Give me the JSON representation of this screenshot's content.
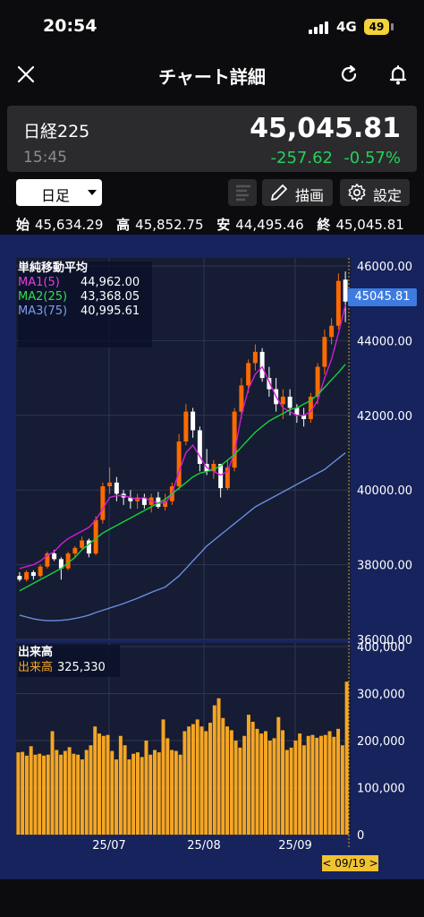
{
  "status_bar": {
    "time": "20:54",
    "network": "4G",
    "battery": "49"
  },
  "header": {
    "title": "チャート詳細"
  },
  "quote": {
    "name": "日経225",
    "price": "45,045.81",
    "time": "15:45",
    "change": "-257.62",
    "change_pct": "-0.57%"
  },
  "toolbar": {
    "period": "日足",
    "draw": "描画",
    "settings": "設定"
  },
  "ohlc": {
    "open_label": "始",
    "open": "45,634.29",
    "high_label": "高",
    "high": "45,852.75",
    "low_label": "安",
    "low": "44,495.46",
    "close_label": "終",
    "close": "45,045.81"
  },
  "ma_legend": {
    "title": "単純移動平均",
    "ma1_label": "MA1(5)",
    "ma1_value": "44,962.00",
    "ma2_label": "MA2(25)",
    "ma2_value": "43,368.05",
    "ma3_label": "MA3(75)",
    "ma3_value": "40,995.61"
  },
  "price_tag": "45045.81",
  "volume_legend": {
    "title": "出来高",
    "label": "出来高",
    "value": "325,330"
  },
  "date_tag": "< 09/19 >",
  "colors": {
    "up": "#ff6a00",
    "down": "#ffffff",
    "ma1": "#d21cd6",
    "ma2": "#16d23a",
    "ma3": "#6b8de0",
    "volume": "#f5a623",
    "bg": "#16235c",
    "plot_bg": "#151c33",
    "up_text": "#25d05b"
  },
  "chart_data": [
    {
      "type": "candlestick",
      "title": "",
      "ylim": [
        36000,
        46000
      ],
      "ytick_labels": [
        "36000.00",
        "38000.00",
        "40000.00",
        "42000.00",
        "44000.00",
        "46000.00"
      ],
      "xtick_labels": [
        "25/07",
        "25/08",
        "25/09"
      ],
      "series": [
        {
          "name": "MA1(5)",
          "values": [
            37900,
            37950,
            38000,
            38100,
            38250,
            38350,
            38550,
            38700,
            38800,
            38900,
            39000,
            39200,
            39500,
            39800,
            39850,
            39850,
            39800,
            39750,
            39800,
            39700,
            39650,
            39650,
            39900,
            40500,
            41000,
            41200,
            40900,
            40600,
            40500,
            40400,
            40500,
            41000,
            42000,
            42700,
            43100,
            43300,
            42900,
            42500,
            42200,
            42100,
            42000,
            42000,
            42100,
            42400,
            43000,
            43500,
            44200,
            44962
          ]
        },
        {
          "name": "MA2(25)",
          "values": [
            37300,
            37400,
            37500,
            37600,
            37700,
            37800,
            37900,
            38050,
            38200,
            38400,
            38550,
            38700,
            38850,
            38950,
            39050,
            39150,
            39250,
            39350,
            39450,
            39550,
            39650,
            39750,
            39900,
            40050,
            40200,
            40350,
            40450,
            40500,
            40550,
            40650,
            40800,
            40950,
            41150,
            41350,
            41550,
            41700,
            41850,
            41950,
            42050,
            42150,
            42200,
            42300,
            42400,
            42550,
            42750,
            42950,
            43150,
            43368
          ]
        },
        {
          "name": "MA3(75)",
          "values": [
            36650,
            36600,
            36550,
            36520,
            36500,
            36500,
            36510,
            36530,
            36560,
            36600,
            36650,
            36720,
            36780,
            36840,
            36900,
            36960,
            37030,
            37100,
            37180,
            37260,
            37330,
            37400,
            37550,
            37700,
            37900,
            38100,
            38300,
            38500,
            38650,
            38800,
            38950,
            39100,
            39250,
            39400,
            39550,
            39650,
            39750,
            39850,
            39950,
            40050,
            40150,
            40250,
            40350,
            40450,
            40550,
            40700,
            40850,
            40996
          ]
        }
      ],
      "candles": [
        [
          37700,
          37800,
          37550,
          37600
        ],
        [
          37600,
          37850,
          37550,
          37800
        ],
        [
          37800,
          37850,
          37600,
          37700
        ],
        [
          37700,
          38000,
          37650,
          37950
        ],
        [
          37950,
          38350,
          37900,
          38300
        ],
        [
          38300,
          38400,
          38100,
          38150
        ],
        [
          38150,
          38200,
          37600,
          37900
        ],
        [
          37900,
          38350,
          37850,
          38300
        ],
        [
          38300,
          38500,
          38200,
          38450
        ],
        [
          38450,
          38750,
          38400,
          38650
        ],
        [
          38650,
          38700,
          38200,
          38300
        ],
        [
          38300,
          39300,
          38250,
          39200
        ],
        [
          39200,
          40200,
          39100,
          40100
        ],
        [
          40100,
          40600,
          39900,
          40200
        ],
        [
          40200,
          40350,
          39700,
          39900
        ],
        [
          39900,
          40000,
          39600,
          39800
        ],
        [
          39800,
          40000,
          39500,
          39700
        ],
        [
          39700,
          39900,
          39500,
          39800
        ],
        [
          39800,
          39900,
          39500,
          39600
        ],
        [
          39600,
          39900,
          39400,
          39800
        ],
        [
          39800,
          39950,
          39500,
          39550
        ],
        [
          39550,
          39900,
          39450,
          39700
        ],
        [
          39700,
          40200,
          39600,
          40100
        ],
        [
          40100,
          41500,
          40000,
          41300
        ],
        [
          41300,
          42300,
          41200,
          42100
        ],
        [
          42100,
          42200,
          41400,
          41600
        ],
        [
          41600,
          41700,
          40500,
          40700
        ],
        [
          40700,
          41100,
          40400,
          40500
        ],
        [
          40500,
          40800,
          40300,
          40700
        ],
        [
          40700,
          40700,
          39800,
          40050
        ],
        [
          40050,
          40800,
          40000,
          40600
        ],
        [
          40600,
          42200,
          40500,
          42100
        ],
        [
          42100,
          43000,
          41900,
          42800
        ],
        [
          42800,
          43500,
          42600,
          43400
        ],
        [
          43400,
          43900,
          43200,
          43700
        ],
        [
          43700,
          43800,
          42900,
          43000
        ],
        [
          43000,
          43300,
          42500,
          42700
        ],
        [
          42700,
          43000,
          42100,
          42300
        ],
        [
          42300,
          42700,
          41900,
          42500
        ],
        [
          42500,
          42700,
          42000,
          42200
        ],
        [
          42200,
          42300,
          41800,
          42000
        ],
        [
          42000,
          42200,
          41700,
          41900
        ],
        [
          41900,
          42600,
          41800,
          42500
        ],
        [
          42500,
          43400,
          42300,
          43300
        ],
        [
          43300,
          44300,
          43100,
          44100
        ],
        [
          44100,
          44600,
          43900,
          44400
        ],
        [
          44400,
          45800,
          44300,
          45600
        ],
        [
          45634.29,
          45852.75,
          44495.46,
          45045.81
        ]
      ]
    },
    {
      "type": "bar",
      "title": "",
      "ylim": [
        0,
        400000
      ],
      "ytick_labels": [
        "0",
        "100,000",
        "200,000",
        "300,000",
        "400,000"
      ],
      "values": [
        175000,
        176000,
        168000,
        188000,
        170000,
        172000,
        168000,
        170000,
        220000,
        180000,
        170000,
        178000,
        186000,
        172000,
        170000,
        160000,
        180000,
        190000,
        230000,
        215000,
        210000,
        212000,
        178000,
        160000,
        210000,
        190000,
        160000,
        172000,
        175000,
        165000,
        200000,
        170000,
        180000,
        175000,
        245000,
        205000,
        180000,
        178000,
        170000,
        220000,
        230000,
        235000,
        245000,
        230000,
        220000,
        238000,
        275000,
        290000,
        248000,
        230000,
        222000,
        200000,
        185000,
        210000,
        255000,
        240000,
        225000,
        215000,
        220000,
        200000,
        205000,
        250000,
        222000,
        180000,
        185000,
        200000,
        215000,
        190000,
        210000,
        212000,
        206000,
        210000,
        212000,
        220000,
        208000,
        225000,
        190000,
        325330
      ]
    }
  ]
}
